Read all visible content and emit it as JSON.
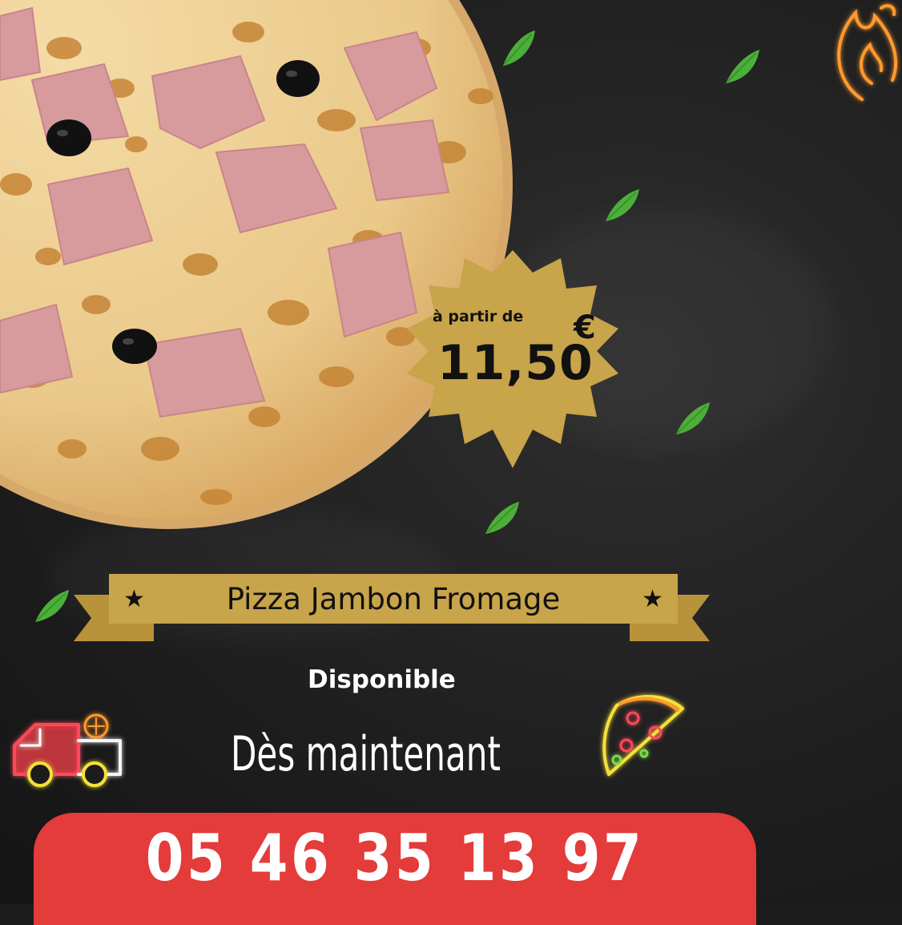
{
  "price": {
    "prefix": "à partir de",
    "value": "11,50",
    "currency": "€"
  },
  "pizza": {
    "name": "Pizza Jambon Fromage",
    "star_left": "★",
    "star_right": "★"
  },
  "availability": {
    "label": "Disponible",
    "subtitle": "Dès maintenant"
  },
  "contact": {
    "phone": "05 46 35 13 97"
  },
  "colors": {
    "background": "#1c1c1c",
    "gold": "#c8a44a",
    "phone_bar": "#e43b3b",
    "leaf": "#4caf3a"
  },
  "icons": [
    "flame-neon-icon",
    "delivery-truck-neon-icon",
    "pizza-slice-neon-icon",
    "basil-leaf-icon"
  ]
}
